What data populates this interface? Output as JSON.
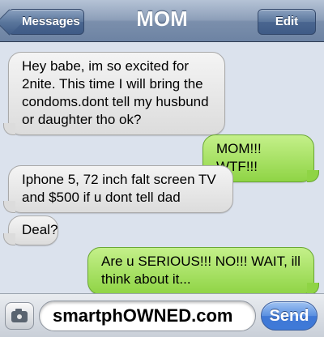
{
  "navbar": {
    "back_label": "Messages",
    "title": "MOM",
    "edit_label": "Edit"
  },
  "messages": [
    {
      "from": "them",
      "text": "Hey babe, im so excited for 2nite. This time I will bring the condoms.dont tell my husbund or daughter tho ok?"
    },
    {
      "from": "me",
      "text": "MOM!!! WTF!!!"
    },
    {
      "from": "them",
      "text": "Iphone 5, 72 inch falt screen TV and $500 if u dont tell dad"
    },
    {
      "from": "them",
      "text": "Deal?"
    },
    {
      "from": "me",
      "text": "Are u SERIOUS!!! NO!!! WAIT, ill think about it..."
    }
  ],
  "composer": {
    "camera_icon": "camera-icon",
    "input_value": "smartphOWNED.com",
    "send_label": "Send"
  },
  "colors": {
    "incoming_bubble": "#dcdcdc",
    "outgoing_bubble": "#8fd445",
    "background": "#dbe2ed",
    "send_button": "#3f78d6"
  }
}
